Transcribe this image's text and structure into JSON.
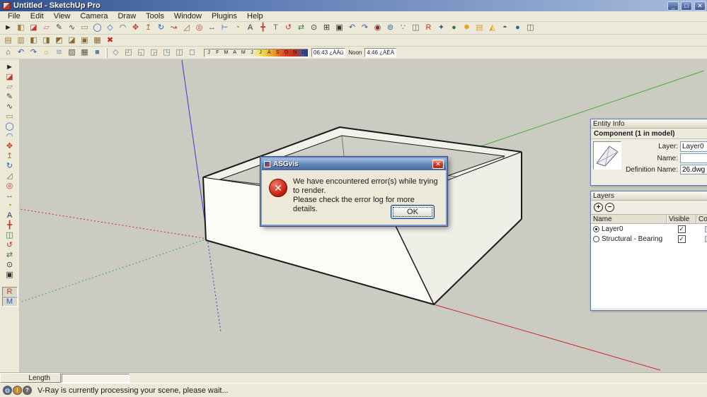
{
  "colors": {
    "chrome": "#ece9d8",
    "viewport_bg": "#cbcbc2",
    "axis_red": "#cc2a2a",
    "axis_green": "#3fae46",
    "axis_blue": "#3a3ad0",
    "titlebar_blue": "#33518e",
    "dialog_error_red": "#c41708"
  },
  "titlebar": {
    "title": "Untitled - SketchUp Pro",
    "buttons": [
      {
        "name": "minimize-button",
        "glyph": "_"
      },
      {
        "name": "maximize-button",
        "glyph": "□"
      },
      {
        "name": "close-button",
        "glyph": "✕"
      }
    ]
  },
  "menubar": {
    "items": [
      "File",
      "Edit",
      "View",
      "Camera",
      "Draw",
      "Tools",
      "Window",
      "Plugins",
      "Help"
    ]
  },
  "toolbar_row1": {
    "icons": [
      {
        "name": "select-tool-icon",
        "glyph": "►",
        "color": "#222222"
      },
      {
        "name": "make-component-icon",
        "glyph": "◧",
        "color": "#a87b3f"
      },
      {
        "name": "paint-bucket-icon",
        "glyph": "◪",
        "color": "#c03a2b"
      },
      {
        "name": "eraser-icon",
        "glyph": "▱",
        "color": "#c06a8a"
      },
      {
        "name": "line-tool-icon",
        "glyph": "✎",
        "color": "#444444"
      },
      {
        "name": "freehand-tool-icon",
        "glyph": "∿",
        "color": "#444444"
      },
      {
        "name": "rectangle-tool-icon",
        "glyph": "▭",
        "color": "#7a9a3a"
      },
      {
        "name": "circle-tool-icon",
        "glyph": "◯",
        "color": "#2a5fb0"
      },
      {
        "name": "polygon-tool-icon",
        "glyph": "◇",
        "color": "#2a5fb0"
      },
      {
        "name": "arc-tool-icon",
        "glyph": "◠",
        "color": "#2a5fb0"
      },
      {
        "name": "move-tool-icon",
        "glyph": "✥",
        "color": "#c03a2b"
      },
      {
        "name": "push-pull-tool-icon",
        "glyph": "↥",
        "color": "#c2641f"
      },
      {
        "name": "rotate-tool-icon",
        "glyph": "↻",
        "color": "#2a5fb0"
      },
      {
        "name": "follow-me-tool-icon",
        "glyph": "↝",
        "color": "#c03a2b"
      },
      {
        "name": "scale-tool-icon",
        "glyph": "◿",
        "color": "#8a6a2f"
      },
      {
        "name": "offset-tool-icon",
        "glyph": "◎",
        "color": "#c03a2b"
      },
      {
        "name": "tape-measure-icon",
        "glyph": "↔",
        "color": "#555555"
      },
      {
        "name": "dimension-icon",
        "glyph": "⊢",
        "color": "#2a5fb0"
      },
      {
        "name": "protractor-icon",
        "glyph": "◔",
        "color": "#b8860b"
      },
      {
        "name": "text-tool-icon",
        "glyph": "A",
        "color": "#333333"
      },
      {
        "name": "axes-tool-icon",
        "glyph": "╋",
        "color": "#c03a2b"
      },
      {
        "name": "3d-text-icon",
        "glyph": "T",
        "color": "#7a4fb0"
      },
      {
        "name": "orbit-tool-icon",
        "glyph": "↺",
        "color": "#c03a2b"
      },
      {
        "name": "pan-tool-icon",
        "glyph": "⇄",
        "color": "#3a7a3a"
      },
      {
        "name": "zoom-tool-icon",
        "glyph": "⊙",
        "color": "#333333"
      },
      {
        "name": "zoom-window-icon",
        "glyph": "⊞",
        "color": "#333333"
      },
      {
        "name": "zoom-extents-icon",
        "glyph": "▣",
        "color": "#333333"
      },
      {
        "name": "previous-view-icon",
        "glyph": "↶",
        "color": "#2a5fb0"
      },
      {
        "name": "next-view-icon",
        "glyph": "↷",
        "color": "#2a5fb0"
      },
      {
        "name": "position-camera-icon",
        "glyph": "◉",
        "color": "#8a2a2a"
      },
      {
        "name": "look-around-icon",
        "glyph": "⊚",
        "color": "#2a6a8a"
      },
      {
        "name": "walk-tool-icon",
        "glyph": "∵",
        "color": "#555555"
      },
      {
        "name": "section-plane-icon",
        "glyph": "◫",
        "color": "#3a7a5a"
      },
      {
        "name": "vray-render-icon",
        "glyph": "R",
        "color": "#c03a2b"
      },
      {
        "name": "vray-options-icon",
        "glyph": "✦",
        "color": "#2a5fb0"
      },
      {
        "name": "vray-material-editor-icon",
        "glyph": "●",
        "color": "#3a7a3a"
      },
      {
        "name": "vray-omni-light-icon",
        "glyph": "✹",
        "color": "#e0a020"
      },
      {
        "name": "vray-rect-light-icon",
        "glyph": "▤",
        "color": "#e0a020"
      },
      {
        "name": "vray-spot-light-icon",
        "glyph": "◭",
        "color": "#e0a020"
      },
      {
        "name": "vray-dome-light-icon",
        "glyph": "◓",
        "color": "#2a5fb0"
      },
      {
        "name": "vray-sphere-icon",
        "glyph": "●",
        "color": "#2a5fb0"
      },
      {
        "name": "vray-infinite-plane-icon",
        "glyph": "◫",
        "color": "#3a7a3a"
      }
    ]
  },
  "toolbar_row2": {
    "icons": [
      {
        "name": "open-model-icon",
        "glyph": "▤",
        "color": "#a87b3f"
      },
      {
        "name": "save-model-icon",
        "glyph": "▥",
        "color": "#a87b3f"
      },
      {
        "name": "group-icon",
        "glyph": "◧",
        "color": "#8a6a2f"
      },
      {
        "name": "component-icon",
        "glyph": "◨",
        "color": "#8a6a2f"
      },
      {
        "name": "outer-shell-icon",
        "glyph": "◩",
        "color": "#8a6a2f"
      },
      {
        "name": "intersect-icon",
        "glyph": "◪",
        "color": "#8a6a2f"
      },
      {
        "name": "box-tool-icon",
        "glyph": "▣",
        "color": "#8a6a2f"
      },
      {
        "name": "stack-icon",
        "glyph": "▦",
        "color": "#8a6a2f"
      },
      {
        "name": "delete-selected-icon",
        "glyph": "✖",
        "color": "#cc2222"
      }
    ]
  },
  "toolbar_row3": {
    "icons_left": [
      {
        "name": "home-view-icon",
        "glyph": "⌂",
        "color": "#555555"
      },
      {
        "name": "camera-undo-icon",
        "glyph": "↶",
        "color": "#2a5fb0"
      },
      {
        "name": "camera-redo-icon",
        "glyph": "↷",
        "color": "#2a5fb0"
      },
      {
        "name": "shadows-toggle-icon",
        "glyph": "☼",
        "color": "#e0a020"
      },
      {
        "name": "fog-toggle-icon",
        "glyph": "≋",
        "color": "#7a9ab0"
      },
      {
        "name": "xray-mode-icon",
        "glyph": "▨",
        "color": "#555555"
      },
      {
        "name": "wireframe-mode-icon",
        "glyph": "▦",
        "color": "#555555"
      },
      {
        "name": "shaded-mode-icon",
        "glyph": "■",
        "color": "#5a7fae"
      }
    ],
    "icons_views": [
      {
        "name": "iso-view-icon",
        "glyph": "◇",
        "color": "#5a7fae"
      },
      {
        "name": "top-view-icon",
        "glyph": "◰",
        "color": "#5a7fae"
      },
      {
        "name": "front-view-icon",
        "glyph": "◱",
        "color": "#5a7fae"
      },
      {
        "name": "right-view-icon",
        "glyph": "◲",
        "color": "#5a7fae"
      },
      {
        "name": "back-view-icon",
        "glyph": "◳",
        "color": "#5a7fae"
      },
      {
        "name": "left-view-icon",
        "glyph": "◫",
        "color": "#5a7fae"
      },
      {
        "name": "bottom-view-icon",
        "glyph": "◻",
        "color": "#5a7fae"
      }
    ],
    "shadows": {
      "months": [
        "J",
        "F",
        "M",
        "A",
        "M",
        "J",
        "J",
        "A",
        "S",
        "O",
        "N",
        "D"
      ],
      "time_morning": "06:43 ¿ÀÀü",
      "noon_label": "Noon",
      "time_evening": "4:46 ¿ÀÈÄ"
    }
  },
  "left_toolbar": {
    "icons": [
      {
        "name": "select-tool-icon",
        "glyph": "►",
        "color": "#222222",
        "state": ""
      },
      {
        "name": "paint-bucket-icon",
        "glyph": "◪",
        "color": "#c03a2b",
        "state": ""
      },
      {
        "name": "eraser-icon",
        "glyph": "▱",
        "color": "#c06a8a",
        "state": ""
      },
      {
        "name": "line-tool-icon",
        "glyph": "✎",
        "color": "#444444",
        "state": ""
      },
      {
        "name": "freehand-tool-icon",
        "glyph": "∿",
        "color": "#444444",
        "state": ""
      },
      {
        "name": "rectangle-tool-icon",
        "glyph": "▭",
        "color": "#7a9a3a",
        "state": ""
      },
      {
        "name": "circle-tool-icon",
        "glyph": "◯",
        "color": "#2a5fb0",
        "state": ""
      },
      {
        "name": "arc-tool-icon",
        "glyph": "◠",
        "color": "#2a5fb0",
        "state": ""
      },
      {
        "name": "move-tool-icon",
        "glyph": "✥",
        "color": "#c03a2b",
        "state": ""
      },
      {
        "name": "push-pull-tool-icon",
        "glyph": "↥",
        "color": "#c2641f",
        "state": ""
      },
      {
        "name": "rotate-tool-icon",
        "glyph": "↻",
        "color": "#2a5fb0",
        "state": ""
      },
      {
        "name": "scale-tool-icon",
        "glyph": "◿",
        "color": "#8a6a2f",
        "state": ""
      },
      {
        "name": "offset-tool-icon",
        "glyph": "◎",
        "color": "#c03a2b",
        "state": ""
      },
      {
        "name": "tape-measure-icon",
        "glyph": "↔",
        "color": "#555555",
        "state": ""
      },
      {
        "name": "protractor-icon",
        "glyph": "◔",
        "color": "#b8860b",
        "state": ""
      },
      {
        "name": "text-tool-icon",
        "glyph": "A",
        "color": "#333333",
        "state": ""
      },
      {
        "name": "axes-tool-icon",
        "glyph": "╋",
        "color": "#c03a2b",
        "state": ""
      },
      {
        "name": "section-plane-icon",
        "glyph": "◫",
        "color": "#3a7a5a",
        "state": ""
      },
      {
        "name": "orbit-tool-icon",
        "glyph": "↺",
        "color": "#c03a2b",
        "state": ""
      },
      {
        "name": "pan-tool-icon",
        "glyph": "⇄",
        "color": "#3a7a3a",
        "state": ""
      },
      {
        "name": "zoom-tool-icon",
        "glyph": "⊙",
        "color": "#333333",
        "state": ""
      },
      {
        "name": "zoom-extents-icon",
        "glyph": "▣",
        "color": "#333333",
        "state": ""
      },
      {
        "name": "vray-render-icon",
        "glyph": "R",
        "color": "#c03a2b",
        "state": "pressed gap"
      },
      {
        "name": "vray-material-editor-icon",
        "glyph": "M",
        "color": "#2a5fb0",
        "state": "pressed"
      }
    ]
  },
  "dialog": {
    "title": "ASGvis",
    "close_glyph": "✕",
    "error_glyph": "✕",
    "message_line1": "We have encountered error(s) while trying to render.",
    "message_line2": "Please check the error log for more details.",
    "ok_label": "OK"
  },
  "entity_info": {
    "title": "Entity Info",
    "component_header": "Component (1 in model)",
    "layer_label": "Layer:",
    "layer_value": "Layer0",
    "name_label": "Name:",
    "name_value": "",
    "definition_label": "Definition Name:",
    "definition_value": "26.dwg"
  },
  "layers_panel": {
    "title": "Layers",
    "add_glyph": "+",
    "remove_glyph": "−",
    "menu_arrow_glyph": "➤",
    "columns": [
      "Name",
      "Visible",
      "Color"
    ],
    "rows": [
      {
        "name": "Layer0",
        "state": "on",
        "check": "✓"
      },
      {
        "name": "Structural - Bearing",
        "state": "off",
        "check": "✓"
      }
    ]
  },
  "statusbar": {
    "length_label": "Length",
    "length_value": "",
    "icons": [
      {
        "name": "geolocation-icon",
        "glyph": "◍",
        "color": "#4a6a8a"
      },
      {
        "name": "credits-icon",
        "glyph": "i",
        "color": "#d08a20"
      },
      {
        "name": "help-icon",
        "glyph": "?",
        "color": "#6a6a6a"
      }
    ],
    "message": "V-Ray is currently processing your scene, please wait..."
  }
}
